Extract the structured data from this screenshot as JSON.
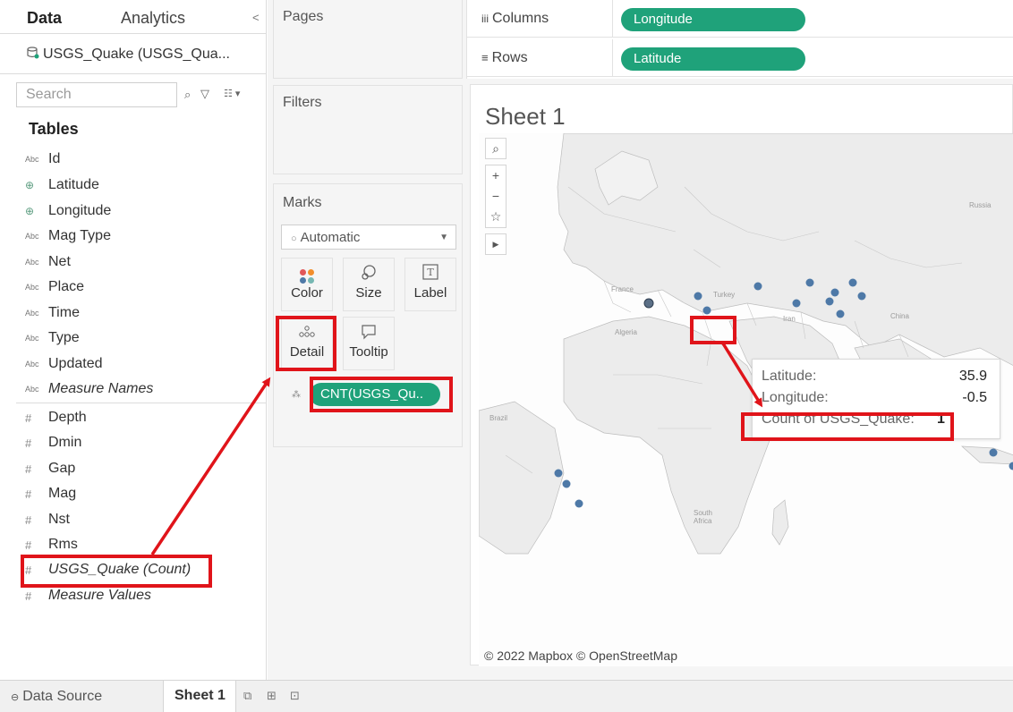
{
  "left_pane": {
    "tab_data": "Data",
    "tab_analytics": "Analytics",
    "collapse_glyph": "<",
    "datasource_name": "USGS_Quake (USGS_Qua...",
    "search_placeholder": "Search",
    "tables_title": "Tables",
    "dimensions": [
      {
        "icon": "Abc",
        "label": "Id"
      },
      {
        "icon": "geo",
        "label": "Latitude"
      },
      {
        "icon": "geo",
        "label": "Longitude"
      },
      {
        "icon": "Abc",
        "label": "Mag Type"
      },
      {
        "icon": "Abc",
        "label": "Net"
      },
      {
        "icon": "Abc",
        "label": "Place"
      },
      {
        "icon": "Abc",
        "label": "Time"
      },
      {
        "icon": "Abc",
        "label": "Type"
      },
      {
        "icon": "Abc",
        "label": "Updated"
      },
      {
        "icon": "Abc",
        "label": "Measure Names"
      }
    ],
    "measures": [
      {
        "icon": "#",
        "label": "Depth"
      },
      {
        "icon": "#",
        "label": "Dmin"
      },
      {
        "icon": "#",
        "label": "Gap"
      },
      {
        "icon": "#",
        "label": "Mag"
      },
      {
        "icon": "#",
        "label": "Nst"
      },
      {
        "icon": "#",
        "label": "Rms"
      },
      {
        "icon": "#",
        "label": "USGS_Quake (Count)"
      },
      {
        "icon": "#",
        "label": "Measure Values"
      }
    ]
  },
  "cards": {
    "pages": "Pages",
    "filters": "Filters",
    "marks": "Marks",
    "mark_type": "Automatic",
    "buttons": {
      "color": "Color",
      "size": "Size",
      "label": "Label",
      "detail": "Detail",
      "tooltip": "Tooltip"
    },
    "detail_pill": "CNT(USGS_Qu.."
  },
  "shelves": {
    "columns_label": "Columns",
    "columns_pill": "Longitude",
    "rows_label": "Rows",
    "rows_pill": "Latitude"
  },
  "view": {
    "sheet_title": "Sheet 1",
    "attribution": "© 2022 Mapbox © OpenStreetMap",
    "map_labels": {
      "russia": "Russia",
      "france": "France",
      "turkey": "Turkey",
      "iran": "Iran",
      "china": "China",
      "algeria": "Algeria",
      "brazil": "Brazil",
      "south_africa": "South Africa"
    },
    "tooltip": {
      "latitude_label": "Latitude:",
      "latitude_value": "35.9",
      "longitude_label": "Longitude:",
      "longitude_value": "-0.5",
      "count_label": "Count of USGS_Quake:",
      "count_value": "1"
    }
  },
  "bottom_tabs": {
    "data_source": "Data Source",
    "sheet1": "Sheet 1"
  },
  "colors": {
    "pill_green": "#1fa27a",
    "mark_blue": "#4e79a7",
    "annotation_red": "#e0141a"
  }
}
